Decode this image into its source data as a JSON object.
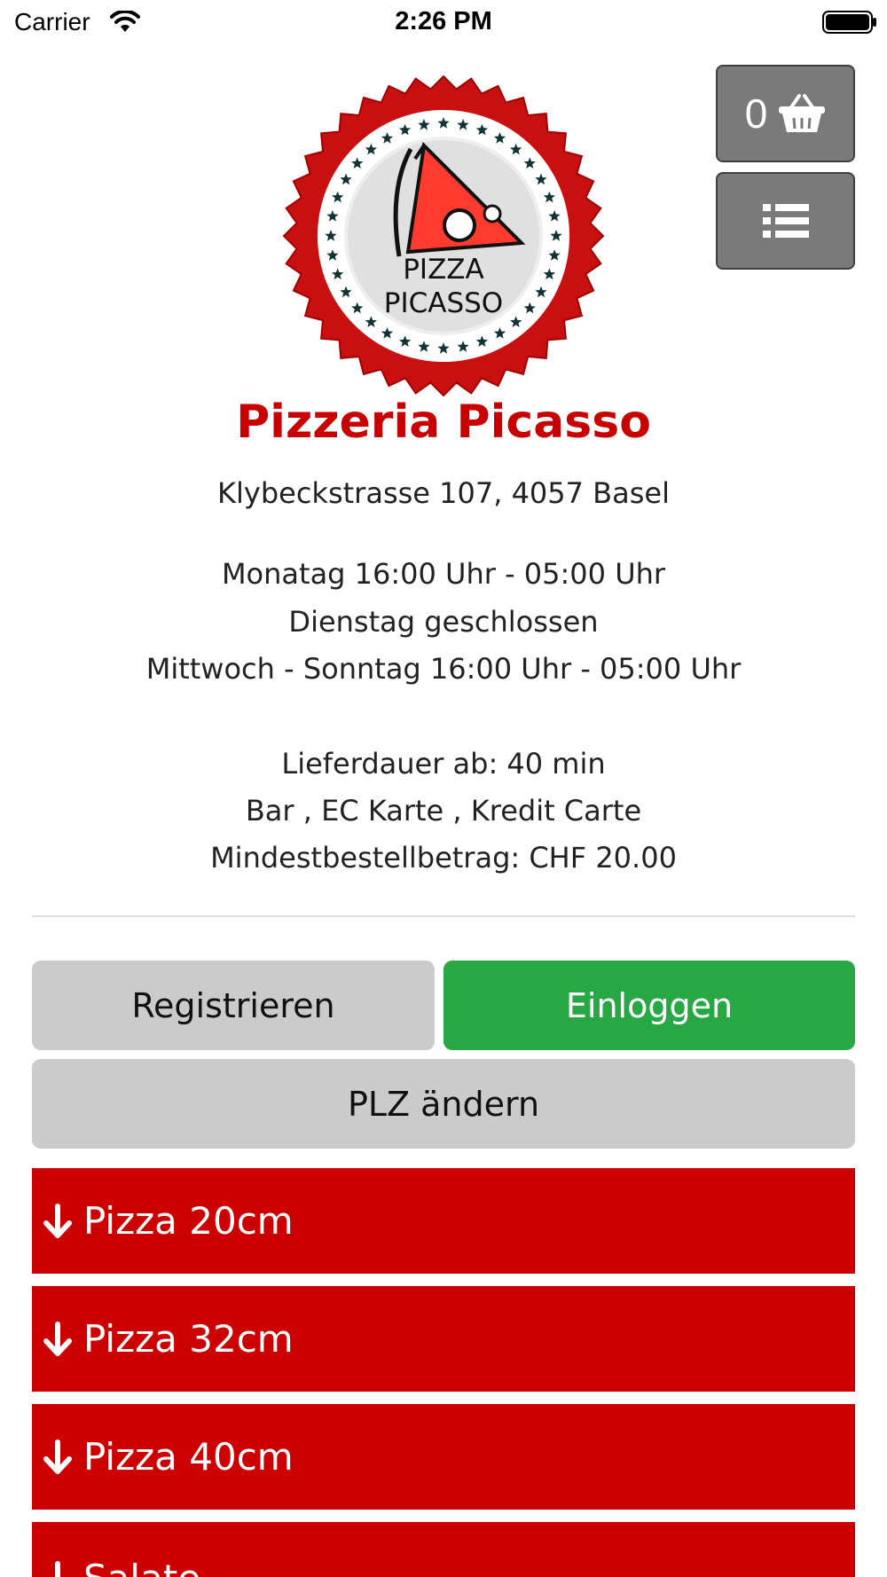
{
  "status_bar": {
    "carrier": "Carrier",
    "time": "2:26 PM"
  },
  "header": {
    "cart_count": "0",
    "cart_icon": "basket-icon",
    "menu_icon": "list-icon"
  },
  "logo": {
    "line1": "PIZZA",
    "line2": "PICASSO"
  },
  "restaurant": {
    "name": "Pizzeria Picasso",
    "address": "Klybeckstrasse 107, 4057 Basel",
    "hours": [
      "Monatag 16:00 Uhr - 05:00 Uhr",
      "Dienstag geschlossen",
      "Mittwoch - Sonntag 16:00 Uhr - 05:00 Uhr"
    ],
    "delivery_time": "Lieferdauer ab: 40 min",
    "payment": "Bar , EC Karte , Kredit Carte",
    "minimum_order": "Mindestbestellbetrag: CHF 20.00"
  },
  "actions": {
    "register": "Registrieren",
    "login": "Einloggen",
    "change_zip": "PLZ ändern"
  },
  "categories": [
    {
      "label": "Pizza 20cm"
    },
    {
      "label": "Pizza 32cm"
    },
    {
      "label": "Pizza 40cm"
    },
    {
      "label": "Salate"
    }
  ],
  "colors": {
    "brand_red": "#cc0000",
    "title_red": "#c80000",
    "login_green": "#28a745",
    "neutral_button": "#cbcbcb",
    "side_button": "#7a7a7a"
  }
}
